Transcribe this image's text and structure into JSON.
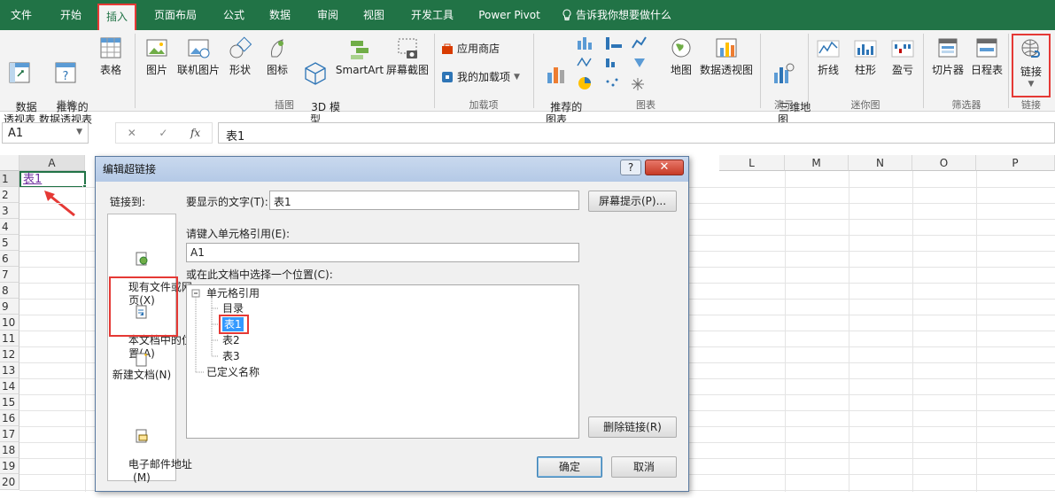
{
  "tabs": [
    {
      "label": "文件",
      "active": false
    },
    {
      "label": "开始",
      "active": false
    },
    {
      "label": "插入",
      "active": true
    },
    {
      "label": "页面布局",
      "active": false
    },
    {
      "label": "公式",
      "active": false
    },
    {
      "label": "数据",
      "active": false
    },
    {
      "label": "审阅",
      "active": false
    },
    {
      "label": "视图",
      "active": false
    },
    {
      "label": "开发工具",
      "active": false
    },
    {
      "label": "Power Pivot",
      "active": false
    }
  ],
  "tell_me": "告诉我你想要做什么",
  "ribbon": {
    "tables": {
      "pivot": "数据\n透视表",
      "recommended_pivot": "推荐的\n数据透视表",
      "table": "表格",
      "group": "表格"
    },
    "illustrations": {
      "picture": "图片",
      "online_picture": "联机图片",
      "shapes": "形状",
      "icons": "图标",
      "model_3d": "3D 模\n型",
      "smartart": "SmartArt",
      "screenshot": "屏幕截图",
      "group": "插图"
    },
    "addins": {
      "store": "应用商店",
      "my_addins": "我的加载项",
      "group": "加载项"
    },
    "charts": {
      "recommended": "推荐的\n图表",
      "maps": "地图",
      "pivot_chart": "数据透视图",
      "group": "图表"
    },
    "tours": {
      "map3d": "三维地\n图",
      "group": "演示"
    },
    "sparklines": {
      "line": "折线",
      "column": "柱形",
      "winloss": "盈亏",
      "group": "迷你图"
    },
    "filters": {
      "slicer": "切片器",
      "timeline": "日程表",
      "group": "筛选器"
    },
    "links": {
      "link": "链接",
      "group": "链接"
    }
  },
  "formula_bar": {
    "name_box": "A1",
    "fx": "fx",
    "content": "表1"
  },
  "columns": [
    "A",
    "L",
    "M",
    "N",
    "O",
    "P"
  ],
  "rows": [
    "1",
    "2",
    "3",
    "4",
    "5",
    "6",
    "7",
    "8",
    "9",
    "10",
    "11",
    "12",
    "13",
    "14",
    "15",
    "16",
    "17",
    "18",
    "19",
    "20"
  ],
  "cell_a1": "表1",
  "dialog": {
    "title": "编辑超链接",
    "help": "?",
    "close": "✕",
    "link_to": "链接到:",
    "link_options": [
      "现有文件或网\n页(X)",
      "本文档中的位\n置(A)",
      "新建文档(N)",
      "电子邮件地址\n(M)"
    ],
    "display_text_label": "要显示的文字(T):",
    "display_text_value": "表1",
    "screentip": "屏幕提示(P)...",
    "cell_ref_label": "请键入单元格引用(E):",
    "cell_ref_value": "A1",
    "place_label": "或在此文档中选择一个位置(C):",
    "tree": {
      "root": "单元格引用",
      "children": [
        "目录",
        "表1",
        "表2",
        "表3"
      ],
      "defined_names": "已定义名称"
    },
    "remove_link": "删除链接(R)",
    "ok": "确定",
    "cancel": "取消"
  }
}
